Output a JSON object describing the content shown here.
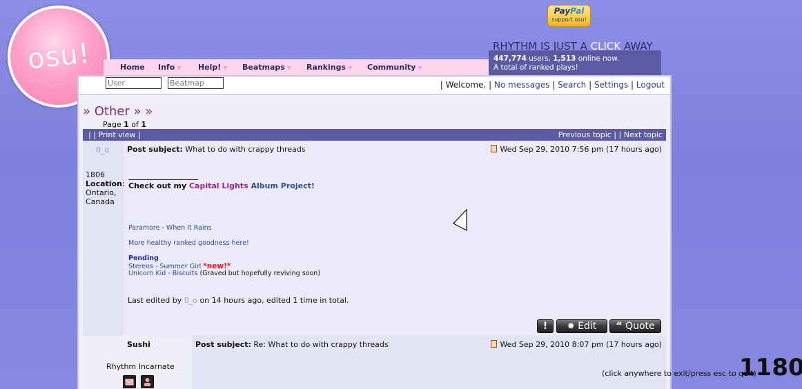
{
  "logo": {
    "text": "osu!"
  },
  "paypal": {
    "brand_a": "Pay",
    "brand_b": "Pal",
    "sub": "support osu!"
  },
  "tagline": {
    "pre": "RHYTHM IS JUST A ",
    "click": "CLICK",
    "post": " AWAY"
  },
  "stats": {
    "users": "447,774",
    "users_label": " users, ",
    "online": "1,513",
    "online_label": " online now.",
    "line2": "A total of ranked plays!"
  },
  "nav": {
    "items": [
      {
        "label": "Home"
      },
      {
        "label": "Info"
      },
      {
        "label": "Help!"
      },
      {
        "label": "Beatmaps"
      },
      {
        "label": "Rankings"
      },
      {
        "label": "Community"
      }
    ]
  },
  "search": {
    "user_placeholder": "User",
    "beatmap_placeholder": "Beatmap"
  },
  "userlinks": {
    "sep": "|",
    "welcome": "Welcome,",
    "messages": "No messages",
    "search": "Search",
    "settings": "Settings",
    "logout": "Logout"
  },
  "forum": {
    "title": "» Other » »",
    "page_pre": "Page ",
    "page_num": "1",
    "page_mid": " of ",
    "page_total": "1"
  },
  "topicbar": {
    "left": "| | Print view |",
    "right": "Previous topic | | Next topic"
  },
  "post1": {
    "author": "0_o",
    "posts": "1806",
    "location_label": "Location:",
    "location_value": "Ontario, Canada",
    "subject_label": "Post subject:",
    "subject": "What to do with crappy threads",
    "date": "Wed Sep 29, 2010 7:56 pm (17 hours ago)",
    "check_pre": "Check out my ",
    "check_link": "Capital Lights",
    "check_post": " Album Project!",
    "map1": "Paramore - When It Rains",
    "more": "More healthy ranked goodness here!",
    "pending_label": "Pending",
    "map2": "Stereos - Summer Girl",
    "new_tag": "*new!*",
    "map3": "Unicorn Kid - Biscuits",
    "map3_note": " (Graved but hopefully reviving soon)",
    "edited_pre": "Last edited by ",
    "edited_user": "0_o",
    "edited_post": " on 14 hours ago, edited 1 time in total.",
    "btn_report": "!",
    "btn_edit": "Edit",
    "btn_quote": "Quote"
  },
  "post2": {
    "author": "Sushi",
    "rank": "Rhythm Incarnate",
    "subject_label": "Post subject:",
    "subject": "Re: What to do with crappy threads",
    "date": "Wed Sep 29, 2010 8:07 pm (17 hours ago)"
  },
  "overlay": {
    "hint": "(click anywhere to exit/press esc to quit)",
    "counter": "1180"
  }
}
